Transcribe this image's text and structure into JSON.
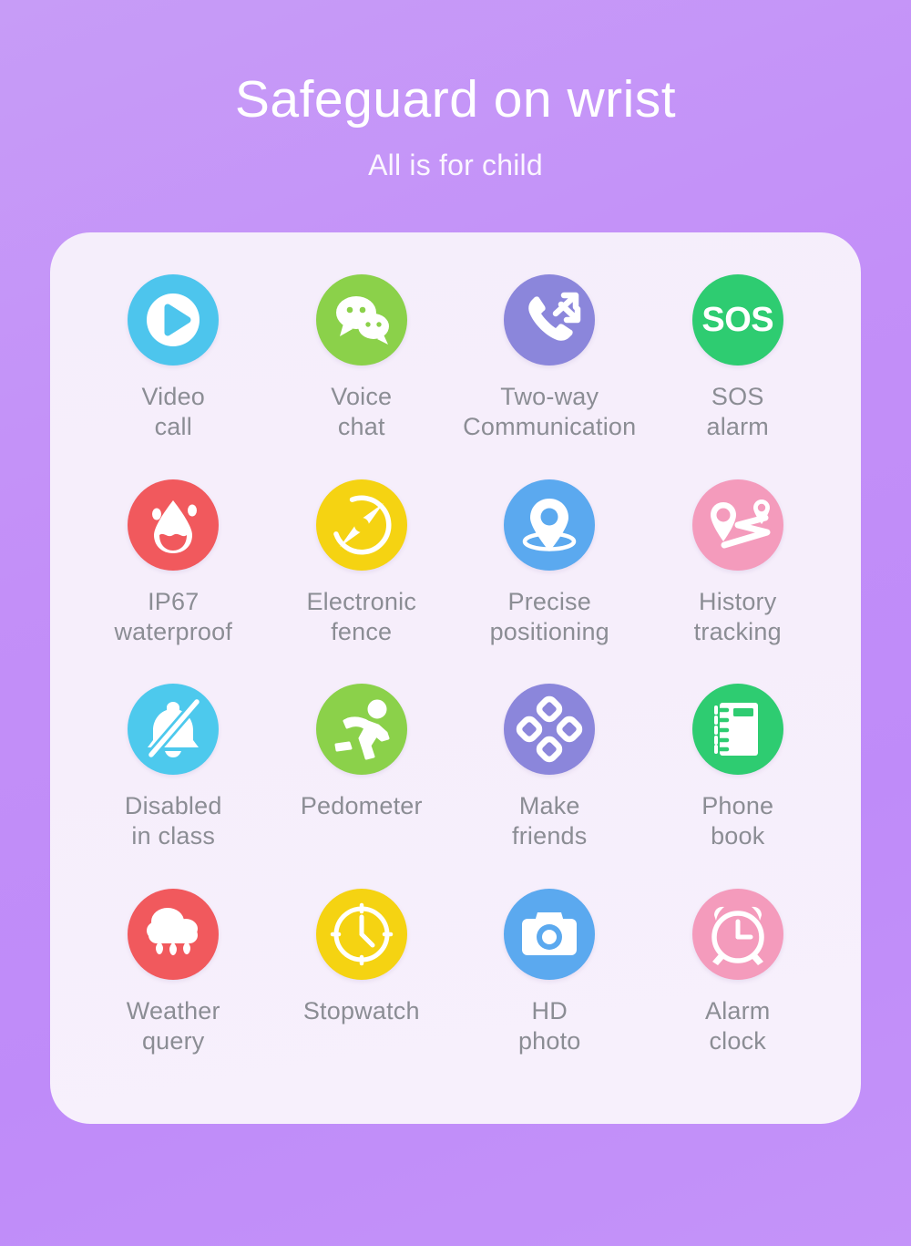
{
  "header": {
    "title": "Safeguard on wrist",
    "subtitle": "All is for child",
    "title_color": "#ffffff",
    "background_color": "#c390f8"
  },
  "card": {
    "background_color": "#f6eefb",
    "label_color": "#8b8d94"
  },
  "features": [
    {
      "id": "video-call",
      "label": "Video\ncall",
      "icon": "video-play-icon",
      "color": "#4dc5ed"
    },
    {
      "id": "voice-chat",
      "label": "Voice\nchat",
      "icon": "speech-bubbles-icon",
      "color": "#8bd14a"
    },
    {
      "id": "two-way-comm",
      "label": "Two-way\nCommunication",
      "icon": "phone-two-way-icon",
      "color": "#8b86db"
    },
    {
      "id": "sos-alarm",
      "label": "SOS\nalarm",
      "icon": "sos-icon",
      "color": "#2ecc71"
    },
    {
      "id": "ip67-waterproof",
      "label": "IP67\nwaterproof",
      "icon": "water-drop-icon",
      "color": "#f1595d"
    },
    {
      "id": "electronic-fence",
      "label": "Electronic\nfence",
      "icon": "compass-icon",
      "color": "#f5d312"
    },
    {
      "id": "precise-positioning",
      "label": "Precise\npositioning",
      "icon": "map-pin-icon",
      "color": "#5ba9ef"
    },
    {
      "id": "history-tracking",
      "label": "History\ntracking",
      "icon": "route-tracking-icon",
      "color": "#f49bbc"
    },
    {
      "id": "disabled-in-class",
      "label": "Disabled\nin class",
      "icon": "bell-muted-icon",
      "color": "#4dc9ed"
    },
    {
      "id": "pedometer",
      "label": "Pedometer",
      "icon": "running-person-icon",
      "color": "#8bd14a"
    },
    {
      "id": "make-friends",
      "label": "Make\nfriends",
      "icon": "clover-petals-icon",
      "color": "#8b86db"
    },
    {
      "id": "phone-book",
      "label": "Phone\nbook",
      "icon": "spiral-notebook-icon",
      "color": "#2ecc71"
    },
    {
      "id": "weather-query",
      "label": "Weather\nquery",
      "icon": "rain-cloud-icon",
      "color": "#f1595d"
    },
    {
      "id": "stopwatch",
      "label": "Stopwatch",
      "icon": "clock-icon",
      "color": "#f5d312"
    },
    {
      "id": "hd-photo",
      "label": "HD\nphoto",
      "icon": "camera-icon",
      "color": "#5ba9ef"
    },
    {
      "id": "alarm-clock",
      "label": "Alarm\nclock",
      "icon": "alarm-clock-icon",
      "color": "#f49bbc"
    }
  ],
  "sos_badge_text": "SOS"
}
